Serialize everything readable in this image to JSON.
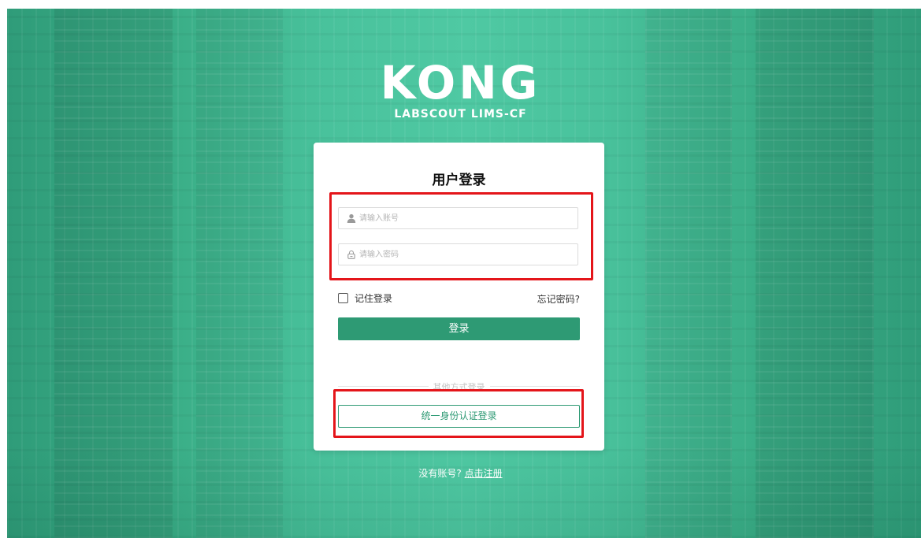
{
  "logo": {
    "title": "KONG",
    "subtitle": "LABSCOUT LIMS-CF"
  },
  "login_card": {
    "title": "用户登录",
    "username": {
      "placeholder": "请输入账号",
      "value": "",
      "icon": "user-icon"
    },
    "password": {
      "placeholder": "请输入密码",
      "value": "",
      "icon": "lock-icon"
    },
    "remember_label": "记住登录",
    "remember_checked": false,
    "forgot_label": "忘记密码?",
    "login_button": "登录",
    "other_methods_label": "其他方式登录",
    "sso_button": "统一身份认证登录"
  },
  "register": {
    "prompt": "没有账号?",
    "link": "点击注册"
  },
  "colors": {
    "brand_green": "#2e9a74",
    "background_green": "#3db68f",
    "highlight_red": "#e4151a"
  }
}
